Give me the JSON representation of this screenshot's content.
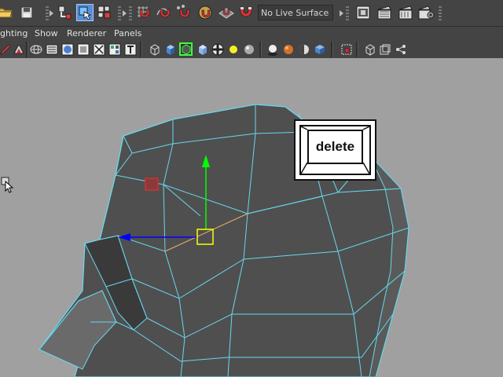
{
  "statusline": {
    "live_surface_label": "No Live Surface",
    "icons": [
      "open-folder-icon",
      "save-scene-icon",
      "select-by-hierarchy-icon",
      "select-by-object-icon",
      "select-by-component-icon",
      "snap-to-grid-icon",
      "snap-to-curve-icon",
      "snap-to-point-icon",
      "snap-to-view-plane-icon",
      "make-live-icon",
      "magnet-icon",
      "render-frame-icon",
      "render-sequence-icon",
      "ipr-render-icon",
      "render-settings-icon"
    ]
  },
  "menubar": {
    "items": [
      "ighting",
      "Show",
      "Renderer",
      "Panels"
    ]
  },
  "paneltoolbar": {
    "icons": [
      "pencil-icon",
      "isolate-select-icon",
      "wireframe-icon",
      "smooth-shade-icon",
      "flat-shade-icon",
      "bounding-box-icon",
      "points-icon",
      "texture-icon",
      "cube-wire-icon",
      "cube-shaded-icon",
      "wireframe-on-shaded-icon",
      "xray-icon",
      "checker-icon",
      "default-light-icon",
      "sphere-shade-icon",
      "shadows-icon",
      "ambient-occlusion-icon",
      "motion-blur-icon",
      "hud-icon",
      "camera-icon",
      "gate-icon",
      "share-icon"
    ]
  },
  "overlay": {
    "key_label": "delete"
  },
  "colors": {
    "ui_background": "#444444",
    "viewport_background": "#a0a0a0",
    "mesh_face": "#4f4f4f",
    "mesh_wire": "#67d8ee",
    "manipulator_y": "#00ff00",
    "manipulator_x": "#0000ff",
    "manipulator_center": "#ffff00",
    "selected_component": "#cc3333"
  }
}
